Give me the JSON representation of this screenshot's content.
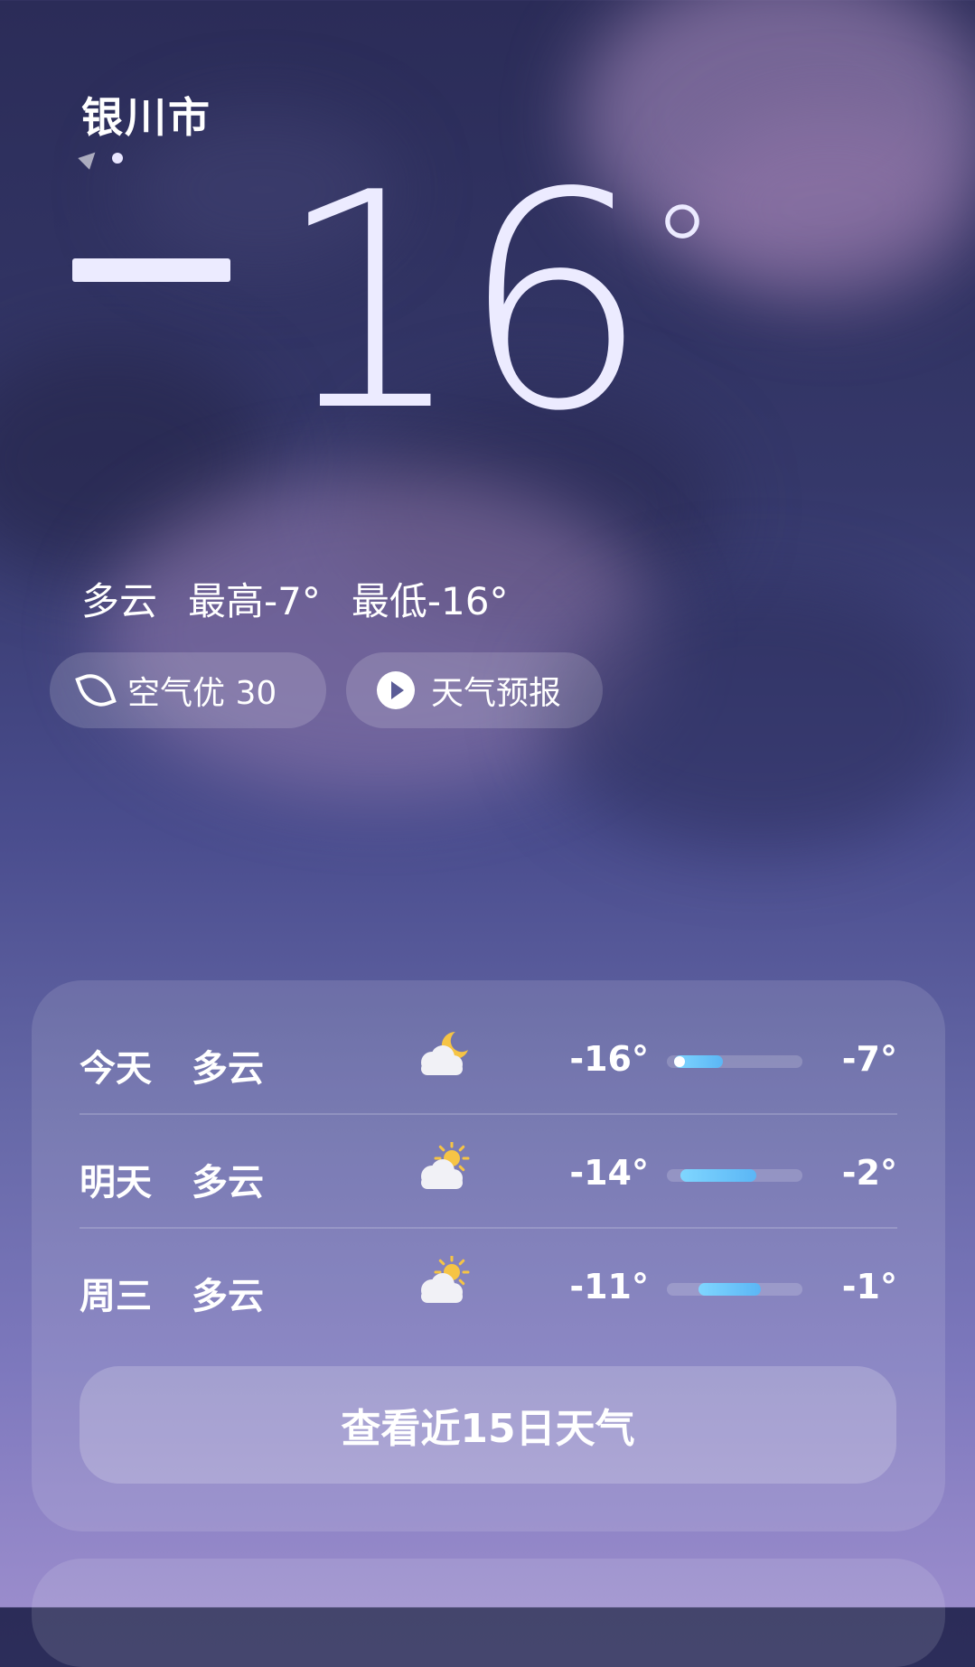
{
  "location": {
    "city": "银川市"
  },
  "current": {
    "temperature": "16",
    "condition": "多云",
    "high": "最高-7°",
    "low": "最低-16°"
  },
  "chips": {
    "aqi_label": "空气优 30",
    "forecast_label": "天气预报"
  },
  "daily": [
    {
      "day": "今天",
      "condition": "多云",
      "icon": "cloudy-night-icon",
      "low": "-16°",
      "high": "-7°",
      "range_start": 0.05,
      "range_end": 0.41,
      "current_marker": 0.05
    },
    {
      "day": "明天",
      "condition": "多云",
      "icon": "partly-cloudy-day-icon",
      "low": "-14°",
      "high": "-2°",
      "range_start": 0.1,
      "range_end": 0.66
    },
    {
      "day": "周三",
      "condition": "多云",
      "icon": "partly-cloudy-day-icon",
      "low": "-11°",
      "high": "-1°",
      "range_start": 0.23,
      "range_end": 0.69
    }
  ],
  "button": {
    "label": "查看近15日天气"
  },
  "colors": {
    "accent_bar": "#5bb6f5",
    "sun": "#f6c445"
  }
}
